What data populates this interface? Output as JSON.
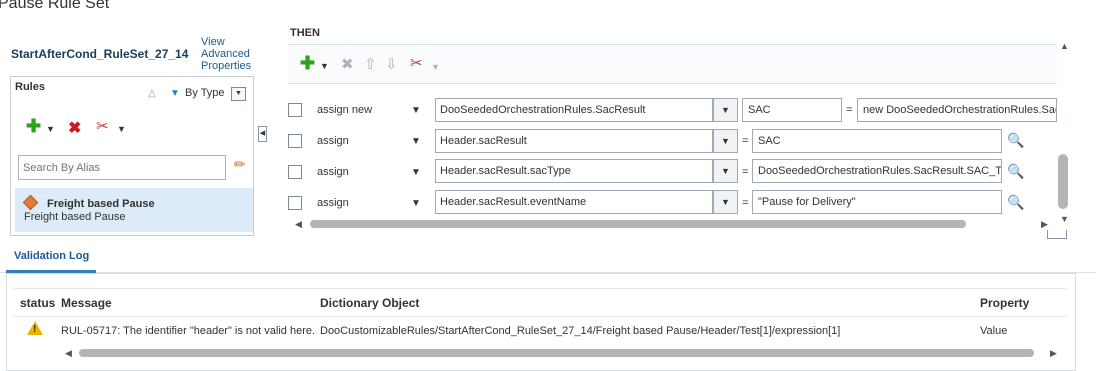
{
  "page": {
    "title": "Pause Rule Set"
  },
  "ruleset": {
    "name": "StartAfterCond_RuleSet_27_14",
    "view_advanced": [
      "View",
      "Advanced",
      "Properties"
    ]
  },
  "rules_panel": {
    "label": "Rules",
    "sort_label": "By Type",
    "search_placeholder": "Search By Alias",
    "items": [
      {
        "name": "Freight based Pause",
        "description": "Freight based Pause"
      }
    ]
  },
  "then_section": {
    "label": "THEN",
    "rows": [
      {
        "action": "assign new",
        "target": "DooSeededOrchestrationRules.SacResult",
        "alias": "SAC",
        "value": "new DooSeededOrchestrationRules.SacResult"
      },
      {
        "action": "assign",
        "target": "Header.sacResult",
        "value": "SAC"
      },
      {
        "action": "assign",
        "target": "Header.sacResult.sacType",
        "value": "DooSeededOrchestrationRules.SacResult.SAC_TYPE"
      },
      {
        "action": "assign",
        "target": "Header.sacResult.eventName",
        "value": "\"Pause for Delivery\""
      }
    ],
    "equals": "="
  },
  "validation_log": {
    "tab_label": "Validation Log",
    "columns": [
      "status",
      "Message",
      "Dictionary Object",
      "Property"
    ],
    "rows": [
      {
        "status": "warning",
        "message": "RUL-05717: The identifier \"header\" is not valid here.",
        "dictionary_object": "DooCustomizableRules/StartAfterCond_RuleSet_27_14/Freight based Pause/Header/Test[1]/expression[1]",
        "property": "Value"
      }
    ]
  },
  "colors": {
    "accent": "#2f7fc2",
    "selected_row": "#dcebf7",
    "warning": "#e8b400",
    "add_green": "#2ea11f",
    "delete_red": "#d21a1a"
  },
  "icons": [
    "add-icon",
    "delete-icon",
    "cut-icon",
    "eraser-icon",
    "search-icon",
    "warning-icon",
    "move-up-icon",
    "move-down-icon"
  ]
}
